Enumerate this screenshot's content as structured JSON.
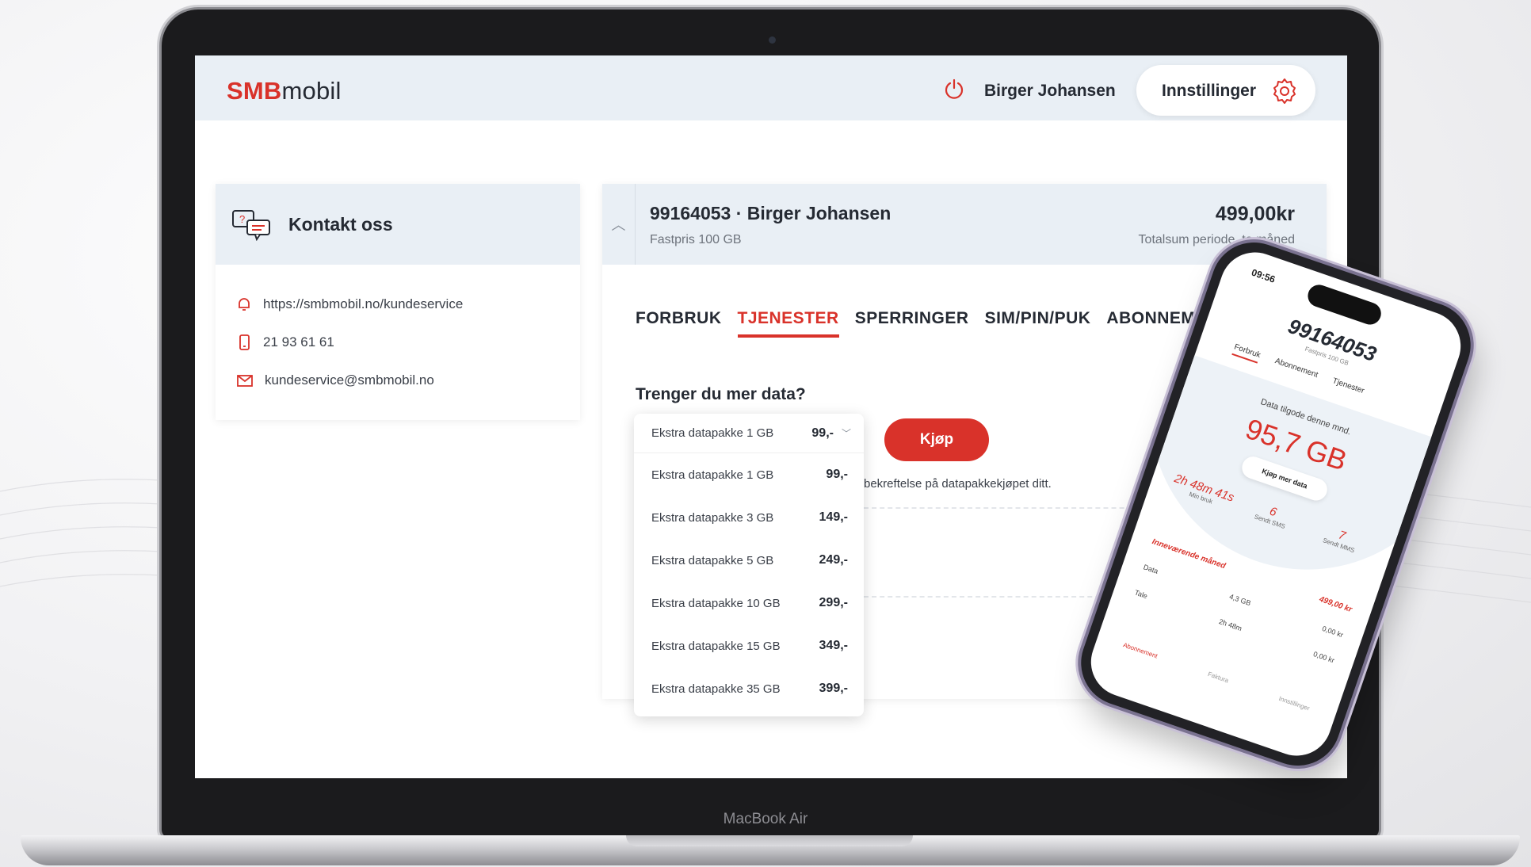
{
  "brand": {
    "logo_bold": "SMB",
    "logo_rest": "mobil",
    "accent": "#d9322a"
  },
  "header": {
    "user": "Birger Johansen",
    "settings_label": "Innstillinger"
  },
  "contact": {
    "title": "Kontakt oss",
    "items": [
      {
        "icon": "bell-icon",
        "text": "https://smbmobil.no/kundeservice"
      },
      {
        "icon": "phone-icon",
        "text": "21 93 61 61"
      },
      {
        "icon": "mail-icon",
        "text": "kundeservice@smbmobil.no"
      }
    ]
  },
  "subscription": {
    "number_name": "99164053 · Birger Johansen",
    "plan": "Fastpris 100 GB",
    "price": "499,00kr",
    "price_label": "Totalsum periode, to måned"
  },
  "tabs": [
    "FORBRUK",
    "TJENESTER",
    "SPERRINGER",
    "SIM/PIN/PUK",
    "ABONNEMENT"
  ],
  "active_tab": "TJENESTER",
  "data_offer": {
    "question": "Trenger du mer data?",
    "selected": {
      "label": "Ekstra datapakke 1 GB",
      "price": "99,-"
    },
    "options": [
      {
        "label": "Ekstra datapakke 1 GB",
        "price": "99,-"
      },
      {
        "label": "Ekstra datapakke 3 GB",
        "price": "149,-"
      },
      {
        "label": "Ekstra datapakke 5 GB",
        "price": "249,-"
      },
      {
        "label": "Ekstra datapakke 10 GB",
        "price": "299,-"
      },
      {
        "label": "Ekstra datapakke 15 GB",
        "price": "349,-"
      },
      {
        "label": "Ekstra datapakke 35 GB",
        "price": "399,-"
      }
    ],
    "buy_label": "Kjøp",
    "confirm_text": "bekreftelse på datapakkekjøpet ditt."
  },
  "laptop": {
    "model": "MacBook Air"
  },
  "phone": {
    "time": "09:56",
    "number": "99164053",
    "plan": "Fastpris 100 GB",
    "tabs": [
      "Forbruk",
      "Abonnement",
      "Tjenester"
    ],
    "data_label": "Data tilgode denne mnd.",
    "data_value": "95,7 GB",
    "buy_more": "Kjøp mer data",
    "stats": [
      {
        "value": "2h 48m 41s",
        "label": "Min bruk"
      },
      {
        "value": "6",
        "label": "Sendt SMS"
      },
      {
        "value": "7",
        "label": "Sendt MMS"
      }
    ],
    "month_label": "Inneværende måned",
    "month_amount": "499,00 kr",
    "rows": [
      {
        "name": "Data",
        "usage": "4,3 GB",
        "amount": "0,00 kr"
      },
      {
        "name": "Tale",
        "usage": "2h 48m",
        "amount": "0,00 kr"
      }
    ],
    "nav": [
      "Abonnement",
      "Faktura",
      "Innstillinger"
    ]
  }
}
